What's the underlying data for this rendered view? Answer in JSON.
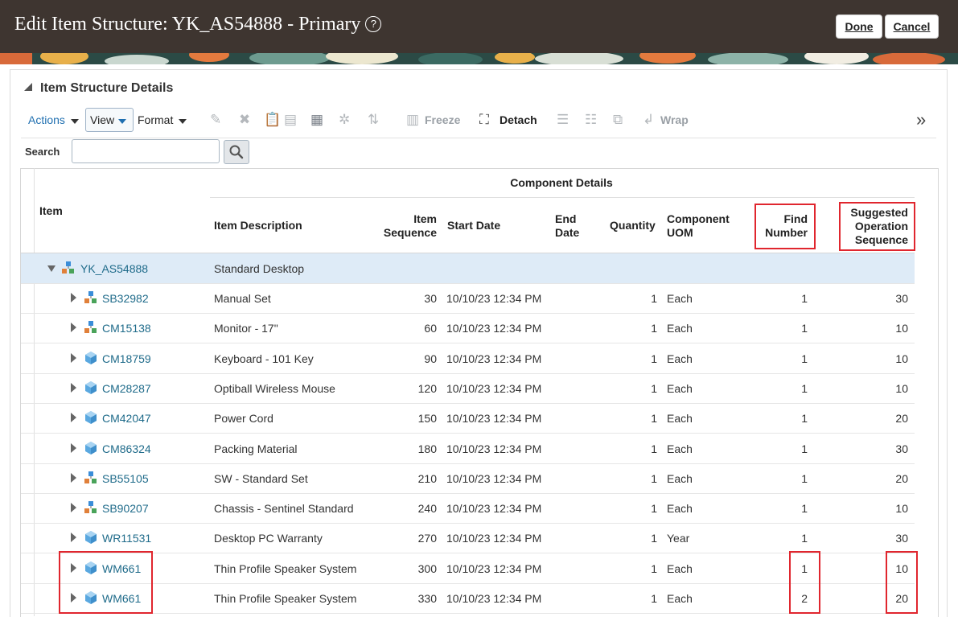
{
  "header": {
    "title": "Edit Item Structure: YK_AS54888 - Primary",
    "help_glyph": "?",
    "done_label": "Done",
    "cancel_label": "Cancel"
  },
  "section": {
    "title": "Item Structure Details"
  },
  "toolbar": {
    "actions_label": "Actions",
    "view_label": "View",
    "format_label": "Format",
    "freeze_label": "Freeze",
    "detach_label": "Detach",
    "wrap_label": "Wrap",
    "overflow_glyph": "»"
  },
  "search": {
    "label": "Search",
    "value": "",
    "placeholder": ""
  },
  "table": {
    "group_header": "Component Details",
    "columns": {
      "item": "Item",
      "description": "Item Description",
      "sequence": [
        "Item",
        "Sequence"
      ],
      "start_date": "Start Date",
      "end_date": [
        "End",
        "Date"
      ],
      "quantity": "Quantity",
      "uom": [
        "Component",
        "UOM"
      ],
      "find_number": [
        "Find",
        "Number"
      ],
      "op_seq": [
        "Suggested",
        "Operation",
        "Sequence"
      ]
    },
    "root": {
      "item": "YK_AS54888",
      "description": "Standard Desktop",
      "icon": "structure-icon"
    },
    "rows": [
      {
        "item": "SB32982",
        "icon": "structure-icon",
        "description": "Manual Set",
        "sequence": "30",
        "start_date": "10/10/23 12:34 PM",
        "end_date": "",
        "quantity": "1",
        "uom": "Each",
        "find_number": "1",
        "op_seq": "30"
      },
      {
        "item": "CM15138",
        "icon": "structure-icon",
        "description": "Monitor - 17\"",
        "sequence": "60",
        "start_date": "10/10/23 12:34 PM",
        "end_date": "",
        "quantity": "1",
        "uom": "Each",
        "find_number": "1",
        "op_seq": "10"
      },
      {
        "item": "CM18759",
        "icon": "item-cube-icon",
        "description": "Keyboard - 101 Key",
        "sequence": "90",
        "start_date": "10/10/23 12:34 PM",
        "end_date": "",
        "quantity": "1",
        "uom": "Each",
        "find_number": "1",
        "op_seq": "10"
      },
      {
        "item": "CM28287",
        "icon": "item-cube-icon",
        "description": "Optiball Wireless Mouse",
        "sequence": "120",
        "start_date": "10/10/23 12:34 PM",
        "end_date": "",
        "quantity": "1",
        "uom": "Each",
        "find_number": "1",
        "op_seq": "10"
      },
      {
        "item": "CM42047",
        "icon": "item-cube-icon",
        "description": "Power Cord",
        "sequence": "150",
        "start_date": "10/10/23 12:34 PM",
        "end_date": "",
        "quantity": "1",
        "uom": "Each",
        "find_number": "1",
        "op_seq": "20"
      },
      {
        "item": "CM86324",
        "icon": "item-cube-icon",
        "description": "Packing Material",
        "sequence": "180",
        "start_date": "10/10/23 12:34 PM",
        "end_date": "",
        "quantity": "1",
        "uom": "Each",
        "find_number": "1",
        "op_seq": "30"
      },
      {
        "item": "SB55105",
        "icon": "structure-icon",
        "description": "SW - Standard Set",
        "sequence": "210",
        "start_date": "10/10/23 12:34 PM",
        "end_date": "",
        "quantity": "1",
        "uom": "Each",
        "find_number": "1",
        "op_seq": "20"
      },
      {
        "item": "SB90207",
        "icon": "structure-icon",
        "description": "Chassis - Sentinel Standard",
        "sequence": "240",
        "start_date": "10/10/23 12:34 PM",
        "end_date": "",
        "quantity": "1",
        "uom": "Each",
        "find_number": "1",
        "op_seq": "10"
      },
      {
        "item": "WR11531",
        "icon": "item-cube-icon",
        "description": "Desktop PC Warranty",
        "sequence": "270",
        "start_date": "10/10/23 12:34 PM",
        "end_date": "",
        "quantity": "1",
        "uom": "Year",
        "find_number": "1",
        "op_seq": "30"
      },
      {
        "item": "WM661",
        "icon": "item-cube-icon",
        "description": "Thin Profile Speaker System",
        "sequence": "300",
        "start_date": "10/10/23 12:34 PM",
        "end_date": "",
        "quantity": "1",
        "uom": "Each",
        "find_number": "1",
        "op_seq": "10"
      },
      {
        "item": "WM661",
        "icon": "item-cube-icon",
        "description": "Thin Profile Speaker System",
        "sequence": "330",
        "start_date": "10/10/23 12:34 PM",
        "end_date": "",
        "quantity": "1",
        "uom": "Each",
        "find_number": "2",
        "op_seq": "20"
      }
    ]
  },
  "colors": {
    "header_bg": "#3e3530",
    "link": "#1f6b8a",
    "selected_row": "#deebf7",
    "highlight": "#e0262e"
  }
}
